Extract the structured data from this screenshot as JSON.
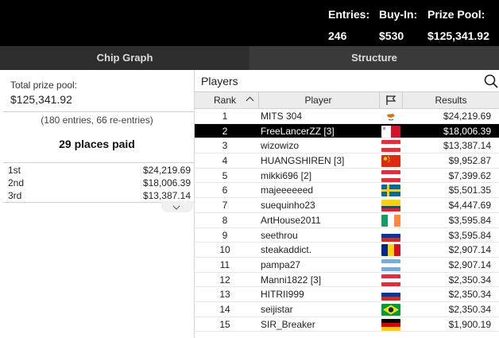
{
  "header": {
    "entries_label": "Entries:",
    "entries_value": "246",
    "buyin_label": "Buy-In:",
    "buyin_value": "$530",
    "prize_label": "Prize Pool:",
    "prize_value": "$125,341.92"
  },
  "tabs": [
    {
      "label": "Chip Graph"
    },
    {
      "label": "Structure"
    }
  ],
  "left_panel": {
    "total_label": "Total prize pool:",
    "total_value": "$125,341.92",
    "entries_info": "(180 entries, 66 re-entries)",
    "places_paid": "29 places paid",
    "payouts": [
      {
        "place": "1st",
        "amount": "$24,219.69"
      },
      {
        "place": "2nd",
        "amount": "$18,006.39"
      },
      {
        "place": "3rd",
        "amount": "$13,387.14"
      }
    ]
  },
  "players_panel": {
    "title": "Players",
    "columns": {
      "rank": "Rank",
      "player": "Player",
      "results": "Results"
    },
    "selected_rank": "2",
    "rows": [
      {
        "rank": "1",
        "player": "MITS 304",
        "flag": "cyprus",
        "result": "$24,219.69"
      },
      {
        "rank": "2",
        "player": "FreeLancerZZ [3]",
        "flag": "malta",
        "result": "$18,006.39"
      },
      {
        "rank": "3",
        "player": "wizowizo",
        "flag": "austria",
        "result": "$13,387.14"
      },
      {
        "rank": "4",
        "player": "HUANGSHIREN [3]",
        "flag": "china",
        "result": "$9,952.87"
      },
      {
        "rank": "5",
        "player": "mikki696 [2]",
        "flag": "austria",
        "result": "$7,399.62"
      },
      {
        "rank": "6",
        "player": "majeeeeeed",
        "flag": "sweden",
        "result": "$5,501.35"
      },
      {
        "rank": "7",
        "player": "suequinho23",
        "flag": "ecuador",
        "result": "$4,447.69"
      },
      {
        "rank": "8",
        "player": "ArtHouse2011",
        "flag": "ireland",
        "result": "$3,595.84"
      },
      {
        "rank": "9",
        "player": "seethrou",
        "flag": "russia",
        "result": "$3,595.84"
      },
      {
        "rank": "10",
        "player": "steakaddict.",
        "flag": "romania",
        "result": "$2,907.14"
      },
      {
        "rank": "11",
        "player": "pampa27",
        "flag": "argentina",
        "result": "$2,907.14"
      },
      {
        "rank": "12",
        "player": "Manni1822 [3]",
        "flag": "austria",
        "result": "$2,350.34"
      },
      {
        "rank": "13",
        "player": "HITRII999",
        "flag": "russia",
        "result": "$2,350.34"
      },
      {
        "rank": "14",
        "player": "seijistar",
        "flag": "brazil",
        "result": "$2,350.34"
      },
      {
        "rank": "15",
        "player": "SIR_Breaker",
        "flag": "germany",
        "result": "$1,900.19"
      }
    ]
  },
  "colors": {
    "header_bg": "#000000",
    "tab_bg": "#3a3a3a",
    "selected_row_bg": "#000000",
    "table_header_bg": "#ececec"
  },
  "icons": {
    "search": "search-icon",
    "flag_column": "flag-icon",
    "sort": "chevron-up-icon",
    "expand": "chevron-down-icon"
  }
}
